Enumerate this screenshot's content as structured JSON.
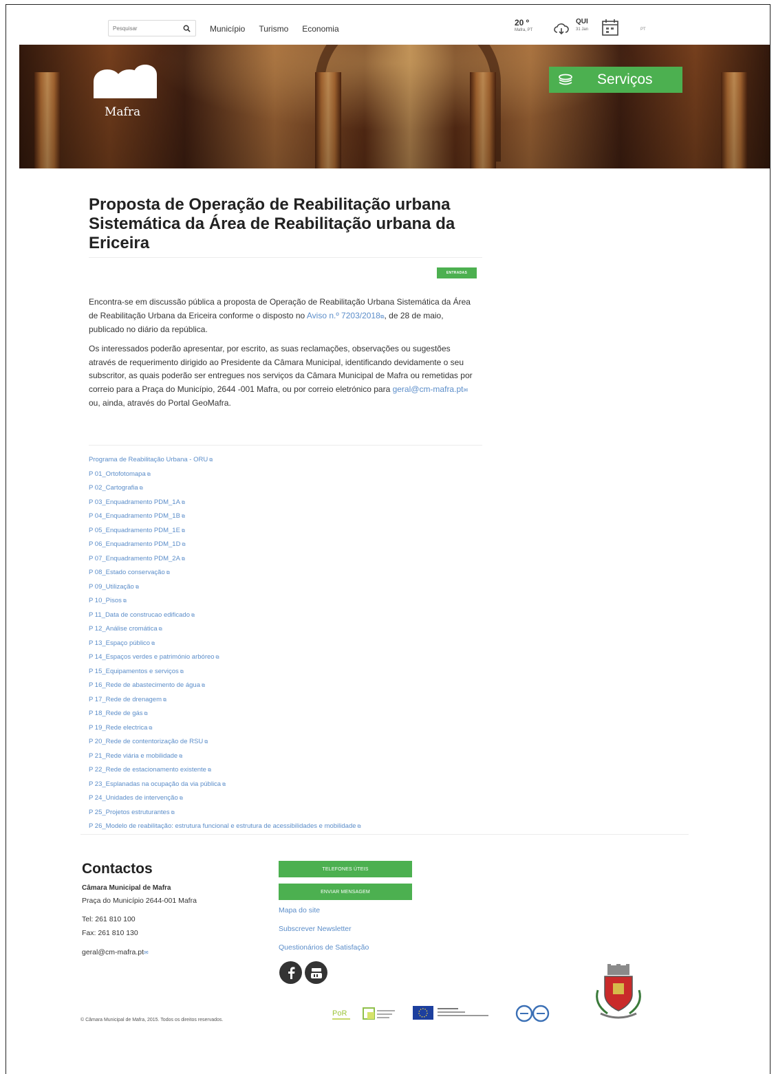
{
  "header": {
    "search_placeholder": "Pesquisar",
    "nav": [
      "Município",
      "Turismo",
      "Economia"
    ],
    "weather_temp": "20 º",
    "weather_location": "Mafra, PT",
    "weekday": "QUI",
    "date": "31 Jan",
    "language": "PT"
  },
  "hero": {
    "logo_text": "Mafra",
    "services_label": "Serviços",
    "services_color": "#4cb050"
  },
  "article": {
    "title": "Proposta de Operação de Reabilitação urbana Sistemática da Área de Reabilitação urbana da Ericeira",
    "tag": "ENTRADAS",
    "p1_a": "Encontra-se em discussão pública a proposta de Operação de Reabilitação Urbana Sistemática da Área de Reabilitação Urbana da Ericeira conforme o disposto no ",
    "p1_link": "Aviso n.º 7203/2018",
    "p1_b": ", de 28 de maio, publicado no diário da república.",
    "p2_a": "Os interessados poderão apresentar, por escrito, as suas reclamações, observações ou sugestões através de requerimento dirigido ao Presidente da Câmara Municipal, identificando devidamente o seu subscritor, as quais poderão ser entregues nos serviços da Câmara Municipal de Mafra ou remetidas por correio para a Praça do Município, 2644 -001 Mafra, ou por correio eletrónico para ",
    "p2_link": "geral@cm-mafra.pt",
    "p2_b": " ou, ainda, através do Portal GeoMafra.",
    "documents": [
      "Programa de Reabilitação Urbana - ORU",
      "P 01_Ortofotomapa",
      "P 02_Cartografia",
      "P 03_Enquadramento PDM_1A",
      "P 04_Enquadramento PDM_1B",
      "P 05_Enquadramento PDM_1E",
      "P 06_Enquadramento PDM_1D",
      "P 07_Enquadramento PDM_2A",
      "P 08_Estado conservação",
      "P 09_Utilização",
      "P 10_Pisos",
      "P 11_Data de construcao edificado",
      "P 12_Análise cromática",
      "P 13_Espaço público",
      "P 14_Espaços verdes e património arbóreo",
      "P 15_Equipamentos e serviços",
      "P 16_Rede de abastecimento de água",
      "P 17_Rede de drenagem",
      "P 18_Rede de gás",
      "P 19_Rede electrica",
      "P 20_Rede de contentorização de RSU",
      "P 21_Rede viária e mobilidade",
      "P 22_Rede de estacionamento existente",
      "P 23_Esplanadas na ocupação da via pública",
      "P 24_Unidades de intervenção",
      "P 25_Projetos estruturantes",
      "P 26_Modelo de reabilitação: estrutura funcional e estrutura de acessibilidades e mobilidade"
    ]
  },
  "footer": {
    "contacts_title": "Contactos",
    "org_name": "Câmara Municipal de Mafra",
    "address": "Praça do Município 2644-001 Mafra",
    "tel": "Tel: 261 810 100",
    "fax": "Fax: 261 810 130",
    "email": "geral@cm-mafra.pt",
    "btn_phones": "TELEFONES ÚTEIS",
    "btn_message": "ENVIAR MENSAGEM",
    "links": [
      "Mapa do site",
      "Subscrever Newsletter",
      "Questionários de Satisfação"
    ],
    "copyright": "© Câmara Municipal de Mafra, 2015. Todos os direitos reservados.",
    "accent_link_color": "#5b8dc9"
  }
}
